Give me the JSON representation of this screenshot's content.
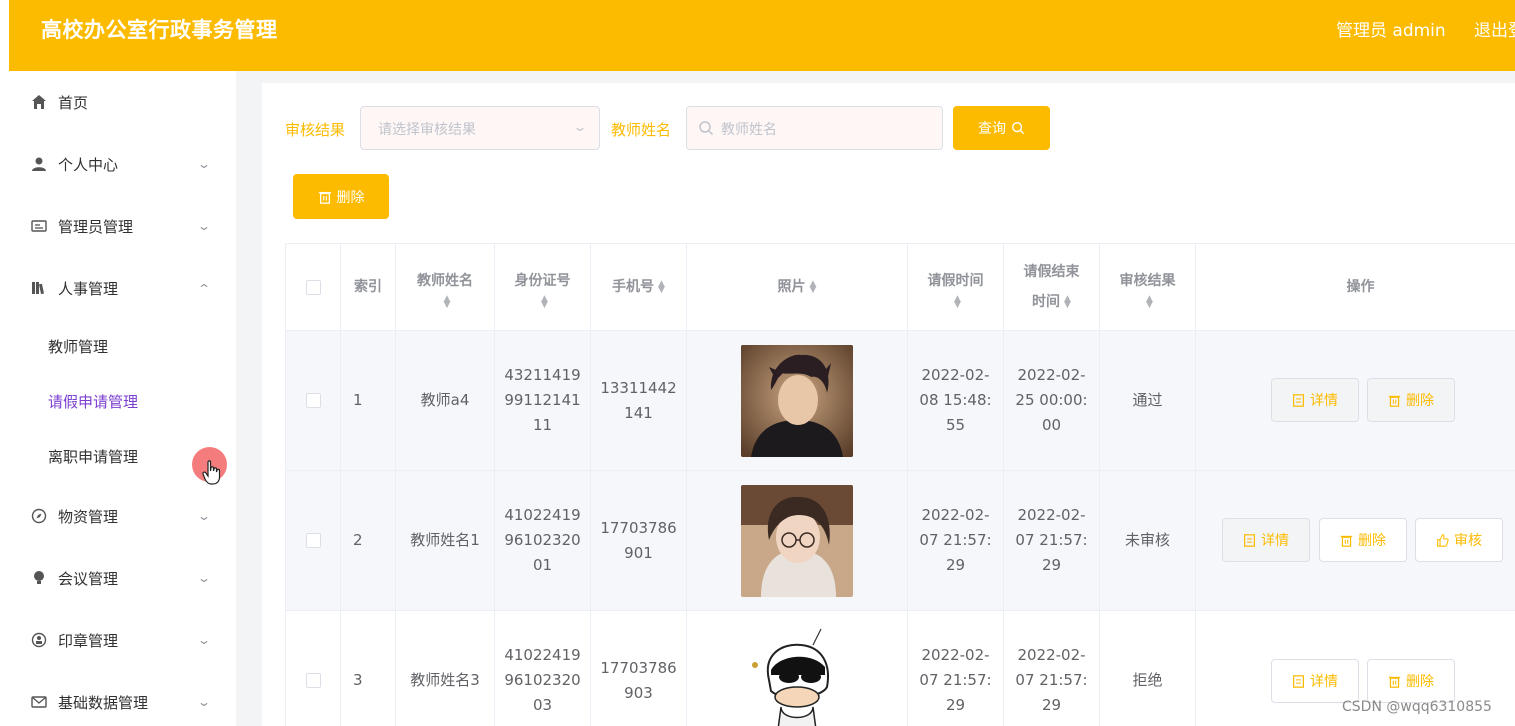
{
  "app": {
    "title": "高校办公室行政事务管理",
    "user_label": "管理员 admin",
    "logout_label": "退出登录",
    "accent_color": "#fdbb00"
  },
  "sidebar": {
    "items": [
      {
        "label": "首页",
        "icon": "home-icon"
      },
      {
        "label": "个人中心",
        "icon": "user-icon"
      },
      {
        "label": "管理员管理",
        "icon": "id-card-icon"
      },
      {
        "label": "人事管理",
        "icon": "library-icon",
        "expanded": true
      },
      {
        "label": "物资管理",
        "icon": "compass-icon"
      },
      {
        "label": "会议管理",
        "icon": "bulb-icon"
      },
      {
        "label": "印章管理",
        "icon": "stamp-icon"
      },
      {
        "label": "基础数据管理",
        "icon": "mail-icon"
      }
    ],
    "sub_items": [
      {
        "label": "教师管理"
      },
      {
        "label": "请假申请管理",
        "active": true
      },
      {
        "label": "离职申请管理"
      }
    ]
  },
  "filters": {
    "result_label": "审核结果",
    "result_placeholder": "请选择审核结果",
    "name_label": "教师姓名",
    "name_placeholder": "教师姓名",
    "search_label": "查询",
    "delete_label": "删除"
  },
  "table": {
    "headers": {
      "index": "索引",
      "name": "教师姓名",
      "id_card": "身份证号",
      "phone": "手机号",
      "photo": "照片",
      "leave_time_a": "请假时间",
      "leave_end_a": "请假结束",
      "leave_end_b": "时间",
      "result": "审核结果",
      "actions": "操作"
    },
    "rows": [
      {
        "index": "1",
        "name": "教师a4",
        "id_a": "43211419",
        "id_b": "99112141",
        "id_c": "11",
        "phone_a": "13311442",
        "phone_b": "141",
        "start_a": "2022-02-",
        "start_b": "08 15:48:",
        "start_c": "55",
        "end_a": "2022-02-",
        "end_b": "25 00:00:",
        "end_c": "00",
        "result": "通过",
        "photo": "portrait-young-man"
      },
      {
        "index": "2",
        "name": "教师姓名1",
        "id_a": "41022419",
        "id_b": "96102320",
        "id_c": "01",
        "phone_a": "17703786",
        "phone_b": "901",
        "start_a": "2022-02-",
        "start_b": "07 21:57:",
        "start_c": "29",
        "end_a": "2022-02-",
        "end_b": "07 21:57:",
        "end_c": "29",
        "result": "未审核",
        "photo": "portrait-young-woman-glasses"
      },
      {
        "index": "3",
        "name": "教师姓名3",
        "id_a": "41022419",
        "id_b": "96102320",
        "id_c": "03",
        "phone_a": "17703786",
        "phone_b": "903",
        "start_a": "2022-02-",
        "start_b": "07 21:57:",
        "start_c": "29",
        "end_a": "2022-02-",
        "end_b": "07 21:57:",
        "end_c": "29",
        "result": "拒绝",
        "photo": "cartoon-boy-sunglasses"
      }
    ],
    "actions": {
      "detail": "详情",
      "delete": "删除",
      "review": "审核"
    }
  },
  "watermark": "CSDN @wqq6310855"
}
